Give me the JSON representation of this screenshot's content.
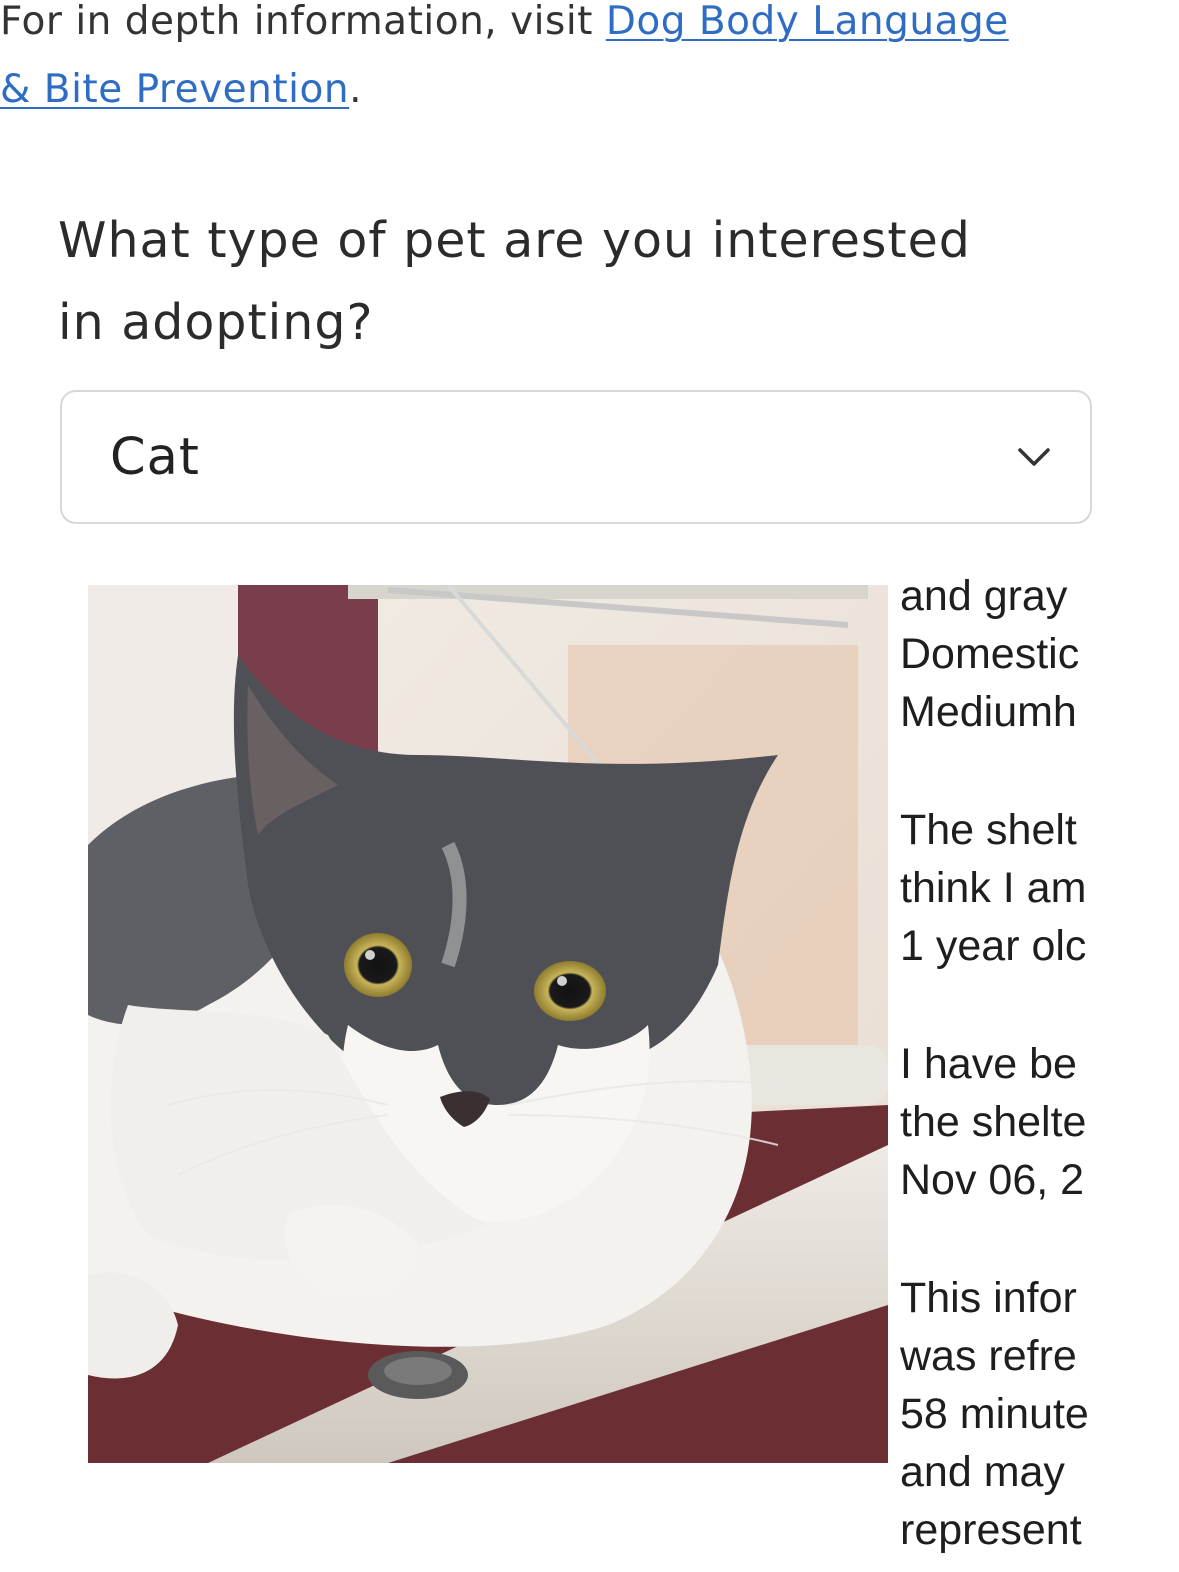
{
  "intro": {
    "prefix": "For in depth information, visit ",
    "link_line1": "Dog Body Language",
    "link_line2": "& Bite Prevention",
    "suffix": "."
  },
  "question": {
    "line1": "What type of pet are you interested",
    "line2": "in adopting?"
  },
  "pet_type_select": {
    "value": "Cat",
    "icon": "chevron-down-icon"
  },
  "listing": {
    "photo_alt": "gray and white cat",
    "blocks": [
      [
        "and gray",
        "Domestic",
        "Mediumh"
      ],
      [
        "The shelt",
        "think I am",
        "1 year olc"
      ],
      [
        "I have be",
        "the shelte",
        "Nov 06, 2"
      ],
      [
        "This infor",
        "was refre",
        "58 minute",
        "and may",
        "represent"
      ]
    ]
  },
  "colors": {
    "link": "#2f6cc4",
    "text": "#2b2b2b",
    "select_border": "#d8d8d8"
  }
}
